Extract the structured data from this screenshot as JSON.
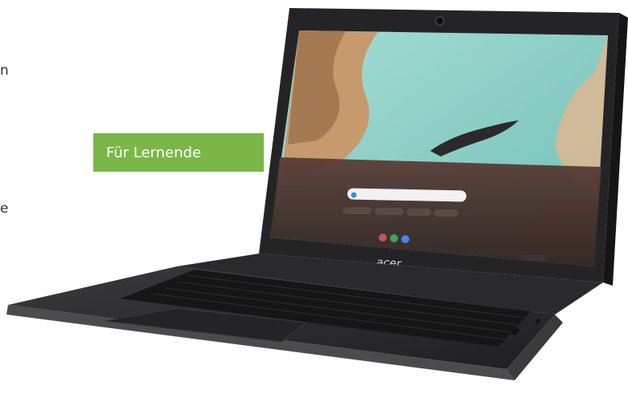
{
  "badge": {
    "label": "Für Lernende"
  },
  "edge_fragments": [
    "n",
    "e"
  ],
  "laptop": {
    "brand": "acer"
  },
  "colors": {
    "badge": "#7ab648",
    "laptop_body": "#2b2b2d",
    "sea": "#8ccfc6",
    "sand": "#c69a6c"
  },
  "icons": [
    "camera-icon",
    "search-icon",
    "chrome-icon",
    "play-store-icon",
    "docs-icon"
  ]
}
